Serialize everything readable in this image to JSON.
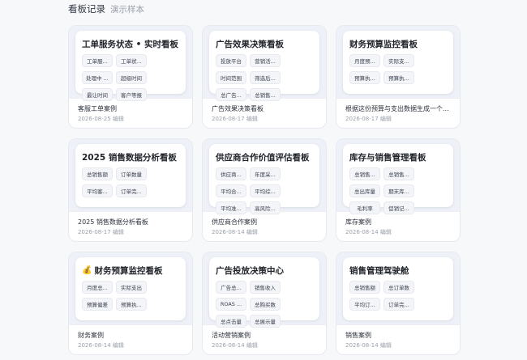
{
  "header": {
    "title": "看板记录",
    "subtitle": "演示样本"
  },
  "cards": [
    {
      "title": "工单服务状态 • 实时看板",
      "emoji": "",
      "chips": [
        "工单服...",
        "工单状...",
        "处理中 ...",
        "超级时间",
        "最让时间",
        "客户等报"
      ],
      "name": "客服工单案例",
      "date": "2026-08-25 编辑"
    },
    {
      "title": "广告效果决策看板",
      "emoji": "",
      "chips": [
        "投放平台",
        "营销活...",
        "时间范围",
        "筛选后...",
        "总广告...",
        "总销售..."
      ],
      "name": "广告效果决策看板",
      "date": "2026-08-17 编辑"
    },
    {
      "title": "财务预算监控看板",
      "emoji": "",
      "chips": [
        "月度预...",
        "实际支...",
        "预算执...",
        "预算执..."
      ],
      "name": "根据这份预算与支出数据生成一个...",
      "date": "2026-08-17 编辑"
    },
    {
      "title": "2025 销售数据分析看板",
      "emoji": "",
      "chips": [
        "总销售额",
        "订单数量",
        "平均客...",
        "订单完..."
      ],
      "name": "2025 销售数据分析看板",
      "date": "2026-08-17 编辑"
    },
    {
      "title": "供应商合作价值评估看板",
      "emoji": "",
      "chips": [
        "供应商...",
        "年度采...",
        "平均合...",
        "平均综...",
        "平均准...",
        "高风险..."
      ],
      "name": "供应商合作案例",
      "date": "2026-08-14 编辑"
    },
    {
      "title": "库存与销售管理看板",
      "emoji": "",
      "chips": [
        "总销售...",
        "总销售...",
        "总出库量",
        "期末库...",
        "毛利率",
        "促销记..."
      ],
      "name": "库存案例",
      "date": "2026-08-14 编辑"
    },
    {
      "title": "财务预算监控看板",
      "emoji": "💰",
      "chips": [
        "月度总...",
        "实际支出",
        "预算偏差",
        "预算执..."
      ],
      "name": "财务案例",
      "date": "2026-08-14 编辑"
    },
    {
      "title": "广告投放决策中心",
      "emoji": "",
      "chips": [
        "广告总...",
        "销售收入",
        "ROAS ...",
        "总购买数",
        "总点击量",
        "总展示量"
      ],
      "name": "活动营销案例",
      "date": "2026-08-14 编辑"
    },
    {
      "title": "销售管理驾驶舱",
      "emoji": "",
      "chips": [
        "总销售额",
        "总订单数",
        "平均订...",
        "订单完..."
      ],
      "name": "销售案例",
      "date": "2026-08-14 编辑"
    }
  ]
}
